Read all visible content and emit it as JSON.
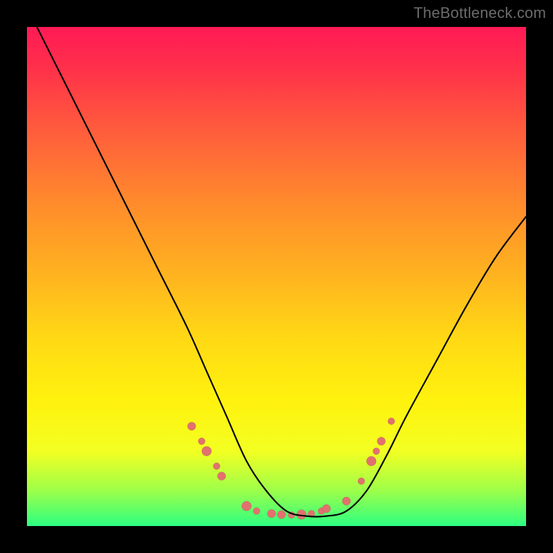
{
  "watermark": "TheBottleneck.com",
  "colors": {
    "frame": "#000000",
    "curve": "#000000",
    "marker": "#e2716e",
    "gradient_stops": [
      "#ff1a56",
      "#ff2f4a",
      "#ff5a3d",
      "#ff8a2c",
      "#ffb41f",
      "#ffd815",
      "#fff20e",
      "#f3ff22",
      "#9cff4a",
      "#2dff82"
    ]
  },
  "chart_data": {
    "type": "line",
    "title": "",
    "xlabel": "",
    "ylabel": "",
    "xlim": [
      0,
      100
    ],
    "ylim": [
      0,
      100
    ],
    "grid": false,
    "series": [
      {
        "name": "curve",
        "x": [
          2,
          8,
          14,
          20,
          26,
          32,
          36,
          40,
          44,
          48,
          52,
          56,
          60,
          64,
          68,
          72,
          76,
          82,
          88,
          94,
          100
        ],
        "y": [
          100,
          88,
          76,
          64,
          52,
          40,
          31,
          22,
          13,
          7,
          3,
          2,
          2,
          3,
          7,
          14,
          22,
          33,
          44,
          54,
          62
        ]
      }
    ],
    "markers": [
      {
        "x": 33,
        "y": 20,
        "r": 6
      },
      {
        "x": 35,
        "y": 17,
        "r": 5
      },
      {
        "x": 36,
        "y": 15,
        "r": 7
      },
      {
        "x": 38,
        "y": 12,
        "r": 5
      },
      {
        "x": 39,
        "y": 10,
        "r": 6
      },
      {
        "x": 44,
        "y": 4,
        "r": 7
      },
      {
        "x": 46,
        "y": 3,
        "r": 5
      },
      {
        "x": 49,
        "y": 2.5,
        "r": 6
      },
      {
        "x": 51,
        "y": 2.3,
        "r": 6
      },
      {
        "x": 53,
        "y": 2.2,
        "r": 5
      },
      {
        "x": 55,
        "y": 2.3,
        "r": 7
      },
      {
        "x": 57,
        "y": 2.5,
        "r": 5
      },
      {
        "x": 59,
        "y": 3,
        "r": 5
      },
      {
        "x": 60,
        "y": 3.5,
        "r": 6
      },
      {
        "x": 64,
        "y": 5,
        "r": 6
      },
      {
        "x": 67,
        "y": 9,
        "r": 5
      },
      {
        "x": 69,
        "y": 13,
        "r": 7
      },
      {
        "x": 70,
        "y": 15,
        "r": 5
      },
      {
        "x": 71,
        "y": 17,
        "r": 6
      },
      {
        "x": 73,
        "y": 21,
        "r": 5
      }
    ]
  }
}
